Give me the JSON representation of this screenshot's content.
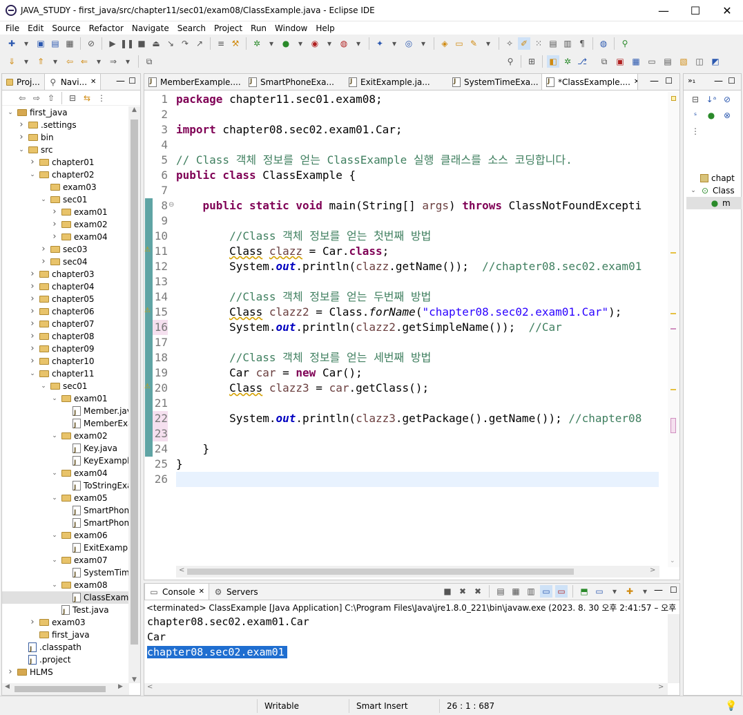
{
  "window": {
    "title": "JAVA_STUDY - first_java/src/chapter11/sec01/exam08/ClassExample.java - Eclipse IDE",
    "minimize": "—",
    "maximize": "☐",
    "close": "✕"
  },
  "menu": [
    "File",
    "Edit",
    "Source",
    "Refactor",
    "Navigate",
    "Search",
    "Project",
    "Run",
    "Window",
    "Help"
  ],
  "left_panel": {
    "tabs": [
      "Proj...",
      "Navi..."
    ],
    "tree": [
      {
        "label": "first_java",
        "depth": 0,
        "kind": "project",
        "open": true
      },
      {
        "label": ".settings",
        "depth": 1,
        "kind": "folder",
        "open": false
      },
      {
        "label": "bin",
        "depth": 1,
        "kind": "folder",
        "open": false
      },
      {
        "label": "src",
        "depth": 1,
        "kind": "folder",
        "open": true
      },
      {
        "label": "chapter01",
        "depth": 2,
        "kind": "folder",
        "open": false
      },
      {
        "label": "chapter02",
        "depth": 2,
        "kind": "folder",
        "open": true
      },
      {
        "label": "exam03",
        "depth": 3,
        "kind": "folder",
        "open": null
      },
      {
        "label": "sec01",
        "depth": 3,
        "kind": "folder",
        "open": true
      },
      {
        "label": "exam01",
        "depth": 4,
        "kind": "folder",
        "open": false
      },
      {
        "label": "exam02",
        "depth": 4,
        "kind": "folder",
        "open": false
      },
      {
        "label": "exam04",
        "depth": 4,
        "kind": "folder",
        "open": false
      },
      {
        "label": "sec03",
        "depth": 3,
        "kind": "folder",
        "open": false
      },
      {
        "label": "sec04",
        "depth": 3,
        "kind": "folder",
        "open": false
      },
      {
        "label": "chapter03",
        "depth": 2,
        "kind": "folder",
        "open": false
      },
      {
        "label": "chapter04",
        "depth": 2,
        "kind": "folder",
        "open": false
      },
      {
        "label": "chapter05",
        "depth": 2,
        "kind": "folder",
        "open": false
      },
      {
        "label": "chapter06",
        "depth": 2,
        "kind": "folder",
        "open": false
      },
      {
        "label": "chapter07",
        "depth": 2,
        "kind": "folder",
        "open": false
      },
      {
        "label": "chapter08",
        "depth": 2,
        "kind": "folder",
        "open": false
      },
      {
        "label": "chapter09",
        "depth": 2,
        "kind": "folder",
        "open": false
      },
      {
        "label": "chapter10",
        "depth": 2,
        "kind": "folder",
        "open": false
      },
      {
        "label": "chapter11",
        "depth": 2,
        "kind": "folder",
        "open": true
      },
      {
        "label": "sec01",
        "depth": 3,
        "kind": "folder",
        "open": true
      },
      {
        "label": "exam01",
        "depth": 4,
        "kind": "folder",
        "open": true
      },
      {
        "label": "Member.java",
        "depth": 5,
        "kind": "file",
        "open": null
      },
      {
        "label": "MemberExa",
        "depth": 5,
        "kind": "file",
        "open": null
      },
      {
        "label": "exam02",
        "depth": 4,
        "kind": "folder",
        "open": true
      },
      {
        "label": "Key.java",
        "depth": 5,
        "kind": "file",
        "open": null
      },
      {
        "label": "KeyExampl",
        "depth": 5,
        "kind": "file",
        "open": null
      },
      {
        "label": "exam04",
        "depth": 4,
        "kind": "folder",
        "open": true
      },
      {
        "label": "ToStringExa",
        "depth": 5,
        "kind": "file",
        "open": null
      },
      {
        "label": "exam05",
        "depth": 4,
        "kind": "folder",
        "open": true
      },
      {
        "label": "SmartPhon",
        "depth": 5,
        "kind": "file",
        "open": null
      },
      {
        "label": "SmartPhon",
        "depth": 5,
        "kind": "file",
        "open": null
      },
      {
        "label": "exam06",
        "depth": 4,
        "kind": "folder",
        "open": true
      },
      {
        "label": "ExitExampl",
        "depth": 5,
        "kind": "file",
        "open": null
      },
      {
        "label": "exam07",
        "depth": 4,
        "kind": "folder",
        "open": true
      },
      {
        "label": "SystemTim",
        "depth": 5,
        "kind": "file",
        "open": null
      },
      {
        "label": "exam08",
        "depth": 4,
        "kind": "folder",
        "open": true
      },
      {
        "label": "ClassExamp",
        "depth": 5,
        "kind": "file",
        "open": null,
        "selected": true
      },
      {
        "label": "Test.java",
        "depth": 4,
        "kind": "file",
        "open": null
      },
      {
        "label": "exam03",
        "depth": 2,
        "kind": "folder",
        "open": false
      },
      {
        "label": "first_java",
        "depth": 2,
        "kind": "folder",
        "open": null
      },
      {
        "label": ".classpath",
        "depth": 1,
        "kind": "xfile",
        "open": null
      },
      {
        "label": ".project",
        "depth": 1,
        "kind": "xfile",
        "open": null
      },
      {
        "label": "HLMS",
        "depth": 0,
        "kind": "project",
        "open": false
      }
    ]
  },
  "editor": {
    "tabs": [
      {
        "label": "MemberExample....",
        "active": false
      },
      {
        "label": "SmartPhoneExa...",
        "active": false
      },
      {
        "label": "ExitExample.ja...",
        "active": false
      },
      {
        "label": "SystemTimeExa...",
        "active": false
      },
      {
        "label": "*ClassExample....",
        "active": true
      }
    ],
    "lines": [
      "1",
      "2",
      "3",
      "4",
      "5",
      "6",
      "7",
      "8",
      "9",
      "10",
      "11",
      "12",
      "13",
      "14",
      "15",
      "16",
      "17",
      "18",
      "19",
      "20",
      "21",
      "22",
      "23",
      "24",
      "25",
      "26"
    ]
  },
  "outline": {
    "items": [
      "chapt",
      "Class",
      "m"
    ]
  },
  "console": {
    "tabs": [
      "Console",
      "Servers"
    ],
    "header": "<terminated> ClassExample [Java Application] C:\\Program Files\\Java\\jre1.8.0_221\\bin\\javaw.exe  (2023. 8. 30 오후 2:41:57 – 오후 2:41:58)",
    "output": [
      "chapter08.sec02.exam01.Car",
      "Car",
      "chapter08.sec02.exam01"
    ]
  },
  "status": {
    "mode": "Writable",
    "insert": "Smart Insert",
    "position": "26 : 1 : 687"
  }
}
